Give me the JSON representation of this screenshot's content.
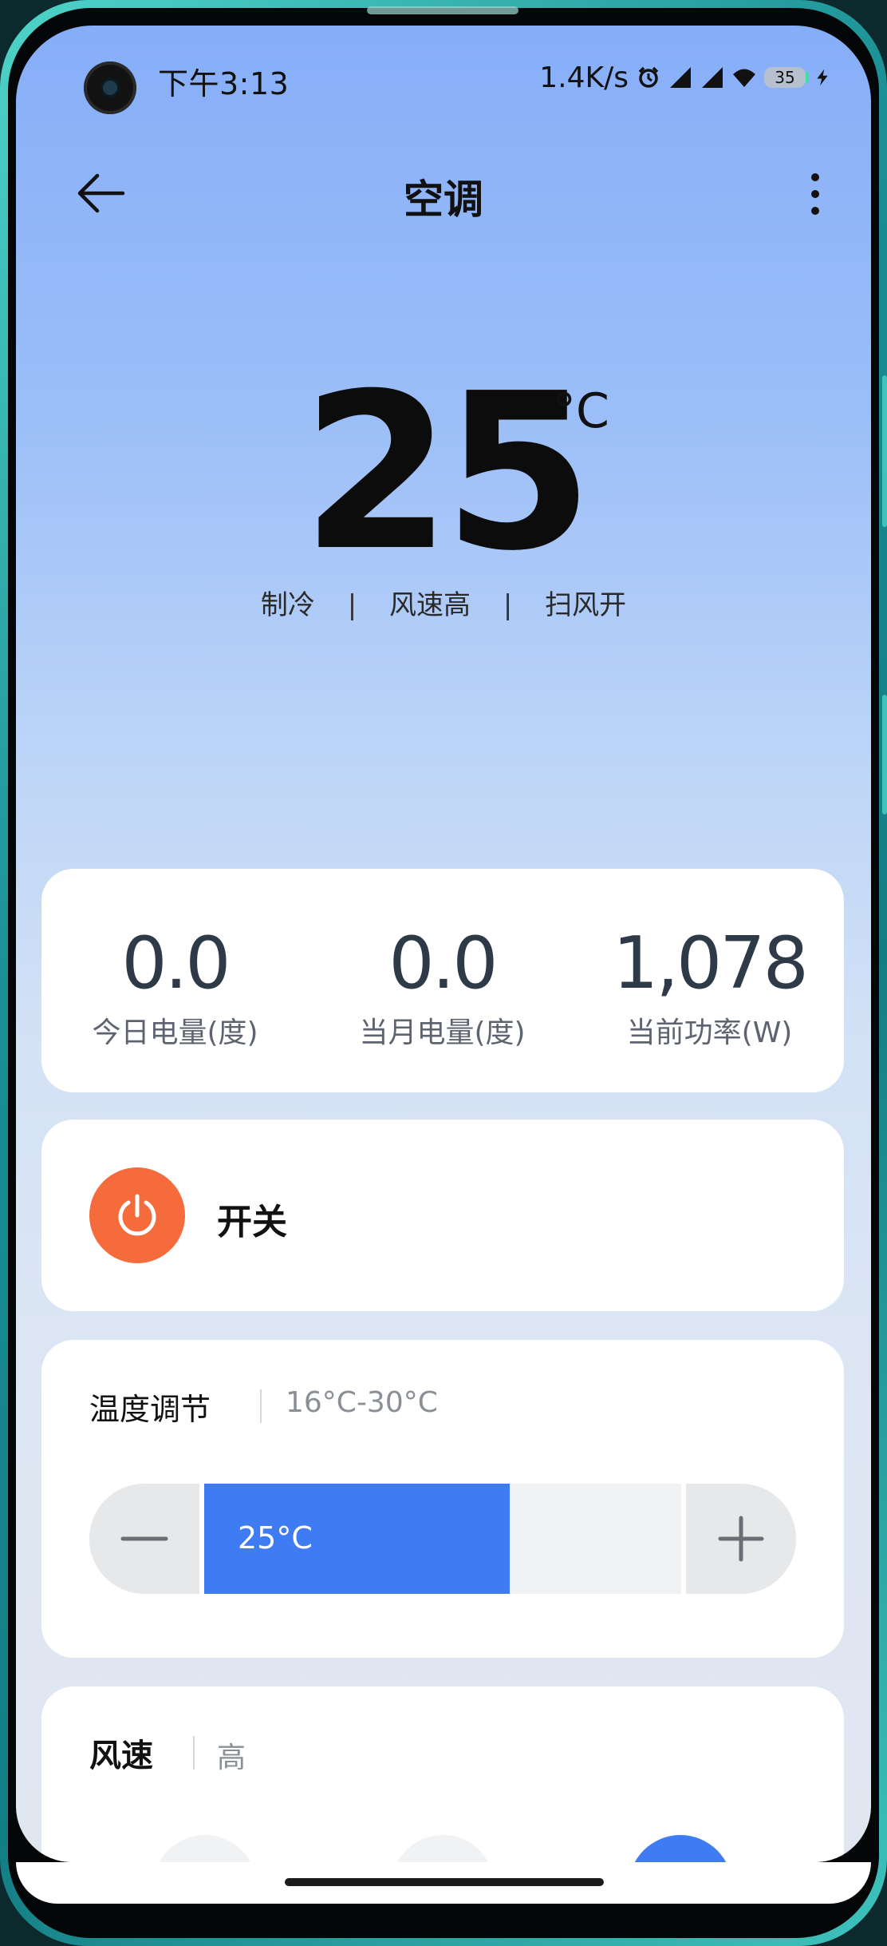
{
  "status_bar": {
    "time": "下午3:13",
    "net_speed": "1.4K/s",
    "battery": "35"
  },
  "app_bar": {
    "title": "空调",
    "back_icon": "arrow-left-icon",
    "more_icon": "more-vertical-icon"
  },
  "current": {
    "temperature": "25",
    "unit": "°C",
    "mode": "制冷",
    "wind": "风速高",
    "swing": "扫风开",
    "separator": "|"
  },
  "stats": [
    {
      "value": "0.0",
      "label": "今日电量(度)"
    },
    {
      "value": "0.0",
      "label": "当月电量(度)"
    },
    {
      "value": "1,078",
      "label": "当前功率(W)"
    }
  ],
  "power": {
    "label": "开关",
    "icon": "power-icon",
    "color": "#f56b3b"
  },
  "temperature_control": {
    "title": "温度调节",
    "range": "16°C-30°C",
    "value_label": "25°C",
    "level": 0.64,
    "fill_color": "#3f7cf3"
  },
  "wind_speed": {
    "title": "风速",
    "value": "高"
  }
}
